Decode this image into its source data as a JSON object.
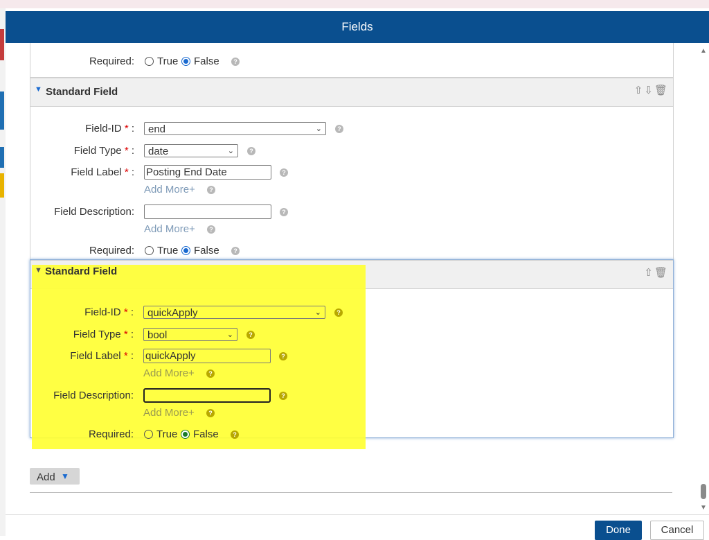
{
  "dialog": {
    "title": "Fields"
  },
  "fields_top": {
    "required_label": "Required:",
    "true_label": "True",
    "false_label": "False"
  },
  "field_end": {
    "header": "Standard Field",
    "field_id_label": "Field-ID",
    "field_id_value": "end",
    "field_type_label": "Field Type",
    "field_type_value": "date",
    "field_label_label": "Field Label",
    "field_label_value": "Posting End Date",
    "add_more": "Add More+",
    "field_description_label": "Field Description:",
    "field_description_value": "",
    "add_more_2": "Add More+",
    "required_label": "Required:",
    "true_label": "True",
    "false_label": "False"
  },
  "field_quick": {
    "header": "Standard Field",
    "field_id_label": "Field-ID",
    "field_id_value": "quickApply",
    "field_type_label": "Field Type",
    "field_type_value": "bool",
    "field_label_label": "Field Label",
    "field_label_value": "quickApply",
    "add_more": "Add More+",
    "field_description_label": "Field Description:",
    "field_description_value": "",
    "add_more_2": "Add More+",
    "required_label": "Required:",
    "true_label": "True",
    "false_label": "False"
  },
  "common": {
    "required_star": "*",
    "colon": ":",
    "help": "?"
  },
  "toolbar": {
    "add_label": "Add",
    "done_label": "Done",
    "cancel_label": "Cancel"
  },
  "colors": {
    "titlebar": "#0a4f8f",
    "highlight": "#ffff33",
    "accent": "#1a6ad0"
  },
  "icons": [
    "move-up-icon",
    "move-down-icon",
    "trash-icon",
    "help-icon",
    "triangle-down-icon"
  ]
}
